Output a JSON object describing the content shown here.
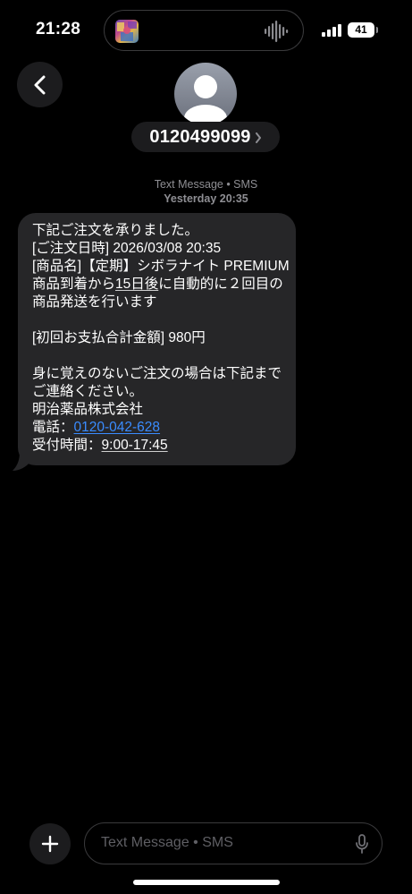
{
  "status_bar": {
    "time": "21:28",
    "battery": "41",
    "icons": [
      "album-art-icon",
      "waveform-icon",
      "signal-icon",
      "battery-icon"
    ]
  },
  "header": {
    "back_icon": "chevron-left-icon",
    "contact_number": "0120499099",
    "contact_chevron": "›"
  },
  "thread": {
    "service_label": "Text Message • SMS",
    "timestamp": "Yesterday 20:35",
    "message": {
      "line1": "下記ご注文を承りました。",
      "line2": "[ご注文日時] 2026/03/08 20:35",
      "line3": "[商品名]【定期】シボラナイト PREMIUM",
      "line4_pre": "商品到着から",
      "line4_ul": "15日後",
      "line4_post": "に自動的に２回目の",
      "line5": "商品発送を行います",
      "line6": "[初回お支払合計金額] 980円",
      "line7": "身に覚えのないご注文の場合は下記まで",
      "line8": "ご連絡ください。",
      "line9": "明治薬品株式会社",
      "phone_label": "電話：",
      "phone_number": "0120-042-628",
      "hours_label": "受付時間：",
      "hours_value": "9:00-17:45"
    }
  },
  "compose": {
    "plus_icon": "plus-icon",
    "placeholder": "Text Message • SMS",
    "mic_icon": "microphone-icon"
  },
  "colors": {
    "background": "#000000",
    "bubble": "#262628",
    "link": "#3a8cff",
    "secondary_text": "#8e8e93"
  }
}
